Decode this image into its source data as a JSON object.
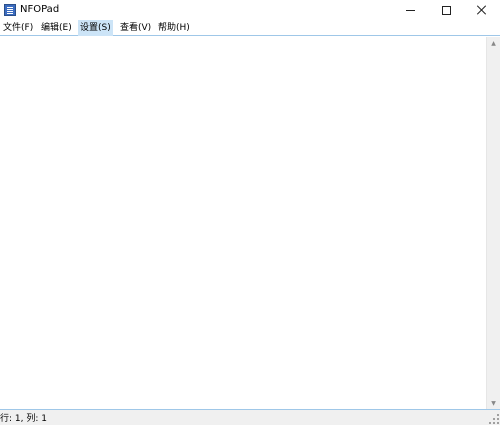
{
  "window": {
    "title": "NFOPad",
    "controls": {
      "minimize_icon": "minimize-icon",
      "maximize_icon": "maximize-icon",
      "close_icon": "close-icon"
    }
  },
  "menu": {
    "items": [
      {
        "label": "文件(F)"
      },
      {
        "label": "编辑(E)"
      },
      {
        "label": "设置(S)",
        "active": true
      },
      {
        "label": "查看(V)"
      },
      {
        "label": "帮助(H)"
      }
    ]
  },
  "editor": {
    "content": ""
  },
  "status": {
    "position": "行: 1, 列: 1"
  },
  "colors": {
    "menu_highlight": "#cce4f7",
    "separator": "#9fc7e8",
    "app_icon": "#3b6cc0"
  }
}
